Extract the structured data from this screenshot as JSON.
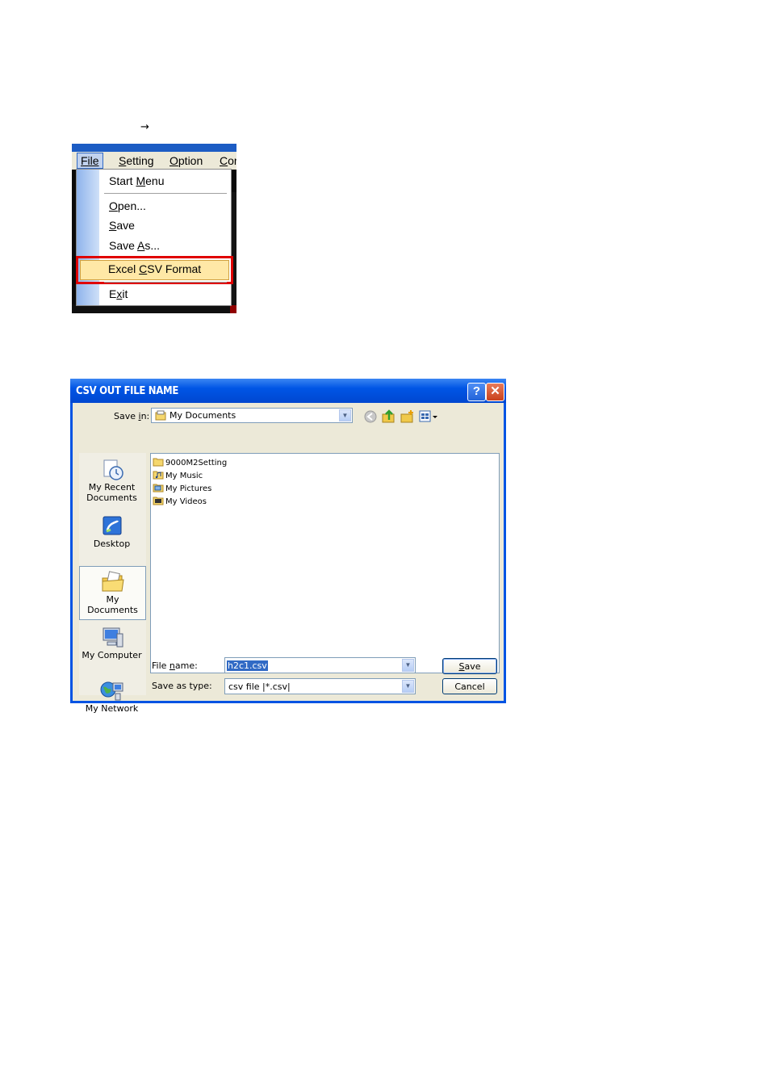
{
  "arrow": "→",
  "menu": {
    "menubar": [
      "File",
      "Setting",
      "Option",
      "Cor"
    ],
    "items": [
      {
        "pre": "Start ",
        "u": "M",
        "post": "enu"
      },
      {
        "pre": "",
        "u": "O",
        "post": "pen..."
      },
      {
        "pre": "",
        "u": "S",
        "post": "ave"
      },
      {
        "pre": "Save ",
        "u": "A",
        "post": "s..."
      },
      {
        "pre": "Excel ",
        "u": "C",
        "post": "SV Format"
      },
      {
        "pre": "E",
        "u": "x",
        "post": "it"
      }
    ],
    "highlighted": "Excel CSV Format",
    "highlight_color": "#e00000"
  },
  "dialog": {
    "title": "CSV OUT FILE NAME",
    "help_label": "?",
    "close_label": "✕",
    "save_in_label": "Save in:",
    "save_in_value": "My Documents",
    "places": [
      "My Recent Documents",
      "Desktop",
      "My Documents",
      "My Computer",
      "My Network"
    ],
    "files": [
      "9000M2Setting",
      "My Music",
      "My Pictures",
      "My Videos"
    ],
    "file_name_label": "File name:",
    "file_name_value": "h2c1.csv",
    "save_as_type_label": "Save as type:",
    "save_as_type_value": "csv file |*.csv|",
    "save_button": "Save",
    "cancel_button": "Cancel",
    "title_color": "#0054e3"
  },
  "icons": [
    "back-icon",
    "up-folder-icon",
    "new-folder-icon",
    "view-menu-icon",
    "folder-icon",
    "music-folder-icon",
    "pictures-folder-icon",
    "videos-folder-icon",
    "recent-documents-icon",
    "desktop-icon",
    "my-documents-icon",
    "my-computer-icon",
    "my-network-icon"
  ]
}
